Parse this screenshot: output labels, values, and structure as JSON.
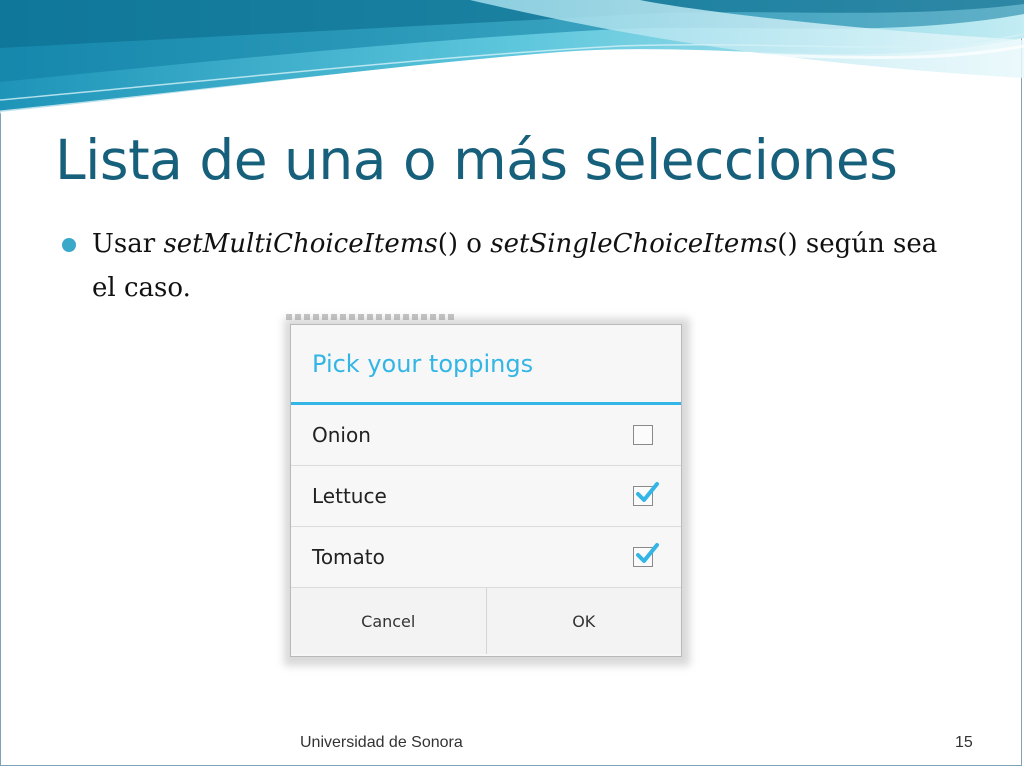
{
  "slide": {
    "title": "Lista de una o más selecciones",
    "bullet": {
      "prefix": "Usar ",
      "method1": "setMultiChoiceItems",
      "mid": "() o ",
      "method2": "setSingleChoiceItems",
      "suffix": "() según sea el caso."
    }
  },
  "dialog": {
    "title": "Pick your toppings",
    "items": [
      {
        "label": "Onion",
        "checked": false
      },
      {
        "label": "Lettuce",
        "checked": true
      },
      {
        "label": "Tomato",
        "checked": true
      }
    ],
    "buttons": {
      "cancel": "Cancel",
      "ok": "OK"
    }
  },
  "footer": {
    "institution": "Universidad de Sonora",
    "page_number": "15"
  },
  "colors": {
    "title": "#17607c",
    "accent": "#33b5e5",
    "bullet": "#3aa9c9"
  },
  "icons": [
    "checkbox-empty-icon",
    "checkbox-checked-icon",
    "bullet-dot-icon"
  ]
}
